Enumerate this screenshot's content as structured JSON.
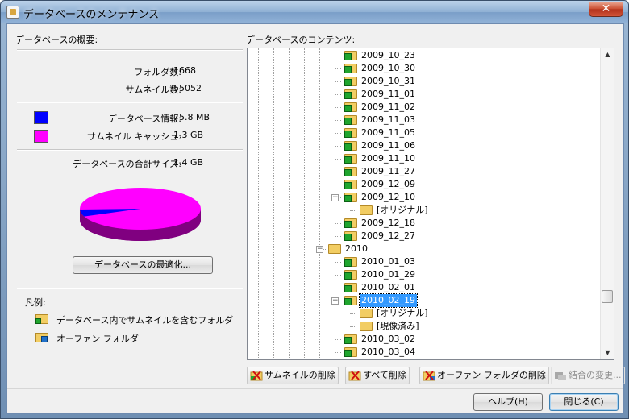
{
  "window": {
    "title": "データベースのメンテナンス",
    "close_glyph": "✕"
  },
  "overview": {
    "heading": "データベースの概要:",
    "folder_count_label": "フォルダ数:",
    "folder_count": "1668",
    "thumb_count_label": "サムネイル数:",
    "thumb_count": "55052",
    "db_info_label": "データベース情報:",
    "db_info_value": "75.8 MB",
    "cache_label": "サムネイル キャッシュ:",
    "cache_value": "1.3 GB",
    "total_label": "データベースの合計サイズ:",
    "total_value": "1.4 GB",
    "optimize_button": "データベースの最適化..."
  },
  "colors": {
    "db_info": "#0000ff",
    "cache": "#ff00ff"
  },
  "chart_data": {
    "type": "pie",
    "values": [
      75.8,
      1331.2
    ],
    "colors": [
      "#0000ff",
      "#ff00ff"
    ],
    "style": "3d"
  },
  "legend": {
    "heading": "凡例:",
    "item_thumbs": "データベース内でサムネイルを含むフォルダ",
    "item_orphan": "オーファン フォルダ"
  },
  "contents": {
    "heading": "データベースのコンテンツ:",
    "rows": [
      {
        "label": "2009_10_23",
        "level": 3,
        "icon": "green"
      },
      {
        "label": "2009_10_30",
        "level": 3,
        "icon": "green"
      },
      {
        "label": "2009_10_31",
        "level": 3,
        "icon": "green"
      },
      {
        "label": "2009_11_01",
        "level": 3,
        "icon": "green"
      },
      {
        "label": "2009_11_02",
        "level": 3,
        "icon": "green"
      },
      {
        "label": "2009_11_03",
        "level": 3,
        "icon": "green"
      },
      {
        "label": "2009_11_05",
        "level": 3,
        "icon": "green"
      },
      {
        "label": "2009_11_06",
        "level": 3,
        "icon": "green"
      },
      {
        "label": "2009_11_10",
        "level": 3,
        "icon": "green"
      },
      {
        "label": "2009_11_27",
        "level": 3,
        "icon": "green"
      },
      {
        "label": "2009_12_09",
        "level": 3,
        "icon": "green"
      },
      {
        "label": "2009_12_10",
        "level": 3,
        "icon": "green",
        "expanded": true
      },
      {
        "label": "[オリジナル]",
        "level": 4,
        "icon": "plain"
      },
      {
        "label": "2009_12_18",
        "level": 3,
        "icon": "green"
      },
      {
        "label": "2009_12_27",
        "level": 3,
        "icon": "green"
      },
      {
        "label": "2010",
        "level": 2,
        "icon": "plain",
        "expanded": true
      },
      {
        "label": "2010_01_03",
        "level": 3,
        "icon": "green"
      },
      {
        "label": "2010_01_29",
        "level": 3,
        "icon": "green"
      },
      {
        "label": "2010_02_01",
        "level": 3,
        "icon": "green"
      },
      {
        "label": "2010_02_19",
        "level": 3,
        "icon": "green",
        "expanded": true,
        "selected": true
      },
      {
        "label": "[オリジナル]",
        "level": 4,
        "icon": "plain"
      },
      {
        "label": "[現像済み]",
        "level": 4,
        "icon": "plain"
      },
      {
        "label": "2010_03_02",
        "level": 3,
        "icon": "green"
      },
      {
        "label": "2010_03_04",
        "level": 3,
        "icon": "green"
      }
    ]
  },
  "toolbar": {
    "delete_thumbs": "サムネイルの削除",
    "delete_all": "すべて削除",
    "delete_orphan": "オーファン フォルダの削除",
    "change_merge": "結合の変更..."
  },
  "footer": {
    "help": "ヘルプ(H)",
    "close": "閉じる(C)"
  }
}
